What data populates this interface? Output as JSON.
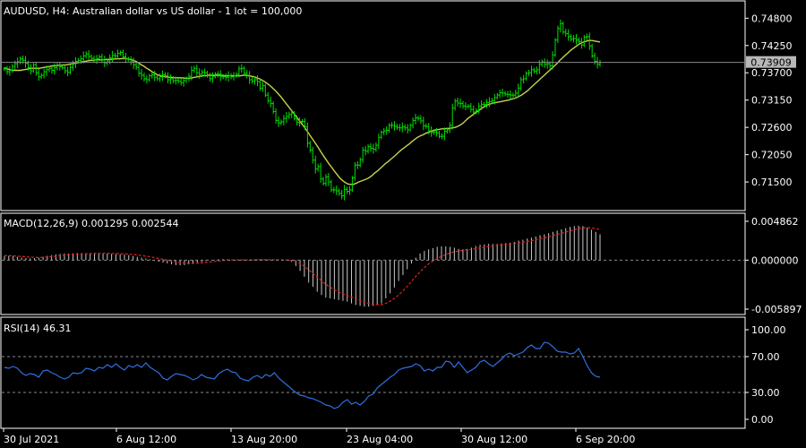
{
  "header": {
    "symbol_line": "AUDUSD, H4:  Australian dollar vs US dollar - 1 lot = 100,000"
  },
  "macd_header": "MACD(12,26,9) 0.001295 0.002544",
  "rsi_header": "RSI(14) 46.31",
  "price_badge": "0.73909",
  "colors": {
    "background": "#000000",
    "candle": "#00e000",
    "ma_line": "#c8d24b",
    "macd_histogram": "#c8c8c8",
    "macd_signal": "#e02020",
    "rsi_line": "#2f6fe0",
    "axis": "#ffffff",
    "level_lines": "#8a8a8a"
  },
  "chart_data": [
    {
      "type": "line",
      "name": "price",
      "x_tick_labels": [
        "30 Jul 2021",
        "6 Aug 12:00",
        "13 Aug 20:00",
        "23 Aug 04:00",
        "30 Aug 12:00",
        "6 Sep 20:00"
      ],
      "y_tick_labels": [
        "0.74800",
        "0.74250",
        "0.73700",
        "0.73150",
        "0.72600",
        "0.72050",
        "0.71500"
      ],
      "ylim": [
        0.7105,
        0.7495
      ],
      "current_price": 0.73909,
      "series": [
        {
          "name": "close",
          "values": [
            0.7378,
            0.7372,
            0.7375,
            0.7383,
            0.7388,
            0.7392,
            0.7398,
            0.7395,
            0.7389,
            0.738,
            0.7374,
            0.7386,
            0.737,
            0.7362,
            0.7365,
            0.7372,
            0.7376,
            0.7379,
            0.7375,
            0.738,
            0.7384,
            0.7382,
            0.738,
            0.7374,
            0.7371,
            0.7381,
            0.7388,
            0.7393,
            0.7395,
            0.7398,
            0.7404,
            0.7408,
            0.7403,
            0.7399,
            0.7396,
            0.7398,
            0.7402,
            0.7396,
            0.739,
            0.7394,
            0.74,
            0.7405,
            0.7404,
            0.7409,
            0.7411,
            0.7402,
            0.7398,
            0.7397,
            0.7392,
            0.7386,
            0.7381,
            0.7369,
            0.7365,
            0.7358,
            0.7356,
            0.7364,
            0.7366,
            0.7361,
            0.7358,
            0.7362,
            0.7366,
            0.7364,
            0.7356,
            0.7358,
            0.7354,
            0.7355,
            0.7353,
            0.735,
            0.7354,
            0.7358,
            0.7363,
            0.7375,
            0.7379,
            0.737,
            0.7367,
            0.7371,
            0.737,
            0.7364,
            0.7358,
            0.7363,
            0.7367,
            0.7367,
            0.7362,
            0.7362,
            0.7361,
            0.7364,
            0.7362,
            0.7364,
            0.7367,
            0.7378,
            0.7379,
            0.7369,
            0.7365,
            0.7356,
            0.7353,
            0.7356,
            0.7352,
            0.7339,
            0.7344,
            0.7325,
            0.7314,
            0.7308,
            0.7292,
            0.7274,
            0.7269,
            0.7271,
            0.7278,
            0.7282,
            0.7286,
            0.7289,
            0.7278,
            0.727,
            0.7272,
            0.7272,
            0.7261,
            0.7228,
            0.7214,
            0.7194,
            0.7176,
            0.7181,
            0.7156,
            0.7147,
            0.716,
            0.715,
            0.7134,
            0.7134,
            0.7132,
            0.7127,
            0.7122,
            0.7135,
            0.7131,
            0.7134,
            0.7158,
            0.7184,
            0.7184,
            0.7195,
            0.7214,
            0.7212,
            0.7221,
            0.7218,
            0.7216,
            0.7224,
            0.724,
            0.725,
            0.7253,
            0.7254,
            0.7264,
            0.7264,
            0.7262,
            0.726,
            0.7259,
            0.7261,
            0.7259,
            0.7255,
            0.7264,
            0.7274,
            0.7279,
            0.7278,
            0.7273,
            0.7263,
            0.7262,
            0.7253,
            0.725,
            0.7251,
            0.7249,
            0.7242,
            0.7242,
            0.7252,
            0.7255,
            0.7264,
            0.7299,
            0.7313,
            0.7309,
            0.7308,
            0.7303,
            0.7302,
            0.7303,
            0.7296,
            0.7291,
            0.7294,
            0.7303,
            0.7306,
            0.7306,
            0.731,
            0.7312,
            0.7314,
            0.732,
            0.7325,
            0.733,
            0.7329,
            0.7327,
            0.7326,
            0.7325,
            0.7325,
            0.7329,
            0.7339,
            0.7356,
            0.7358,
            0.7369,
            0.737,
            0.7376,
            0.7373,
            0.7376,
            0.7387,
            0.7392,
            0.7387,
            0.7388,
            0.7384,
            0.7406,
            0.7436,
            0.7459,
            0.7469,
            0.7452,
            0.7449,
            0.7443,
            0.7438,
            0.7439,
            0.7436,
            0.7433,
            0.7426,
            0.7442,
            0.7443,
            0.7424,
            0.7404,
            0.7393,
            0.7387,
            0.7391
          ]
        },
        {
          "name": "moving_average",
          "values": [
            0.738,
            0.7378,
            0.7376,
            0.7375,
            0.7375,
            0.7375,
            0.7375,
            0.7376,
            0.7377,
            0.7378,
            0.7379,
            0.7379,
            0.7379,
            0.7379,
            0.738,
            0.7381,
            0.7382,
            0.7383,
            0.7384,
            0.7384,
            0.7385,
            0.7385,
            0.7386,
            0.7386,
            0.7387,
            0.7388,
            0.7389,
            0.739,
            0.7391,
            0.7392,
            0.7393,
            0.7394,
            0.7395,
            0.7395,
            0.7396,
            0.7396,
            0.7396,
            0.7396,
            0.7397,
            0.7397,
            0.7397,
            0.7398,
            0.7398,
            0.7398,
            0.7399,
            0.7399,
            0.7398,
            0.7397,
            0.7395,
            0.7393,
            0.739,
            0.7386,
            0.7383,
            0.7379,
            0.7376,
            0.7372,
            0.7369,
            0.7366,
            0.7364,
            0.7363,
            0.7362,
            0.7361,
            0.7361,
            0.736,
            0.736,
            0.736,
            0.736,
            0.7359,
            0.7359,
            0.7359,
            0.736,
            0.7361,
            0.7362,
            0.7363,
            0.7364,
            0.7364,
            0.7365,
            0.7365,
            0.7365,
            0.7365,
            0.7365,
            0.7365,
            0.7364,
            0.7364,
            0.7364,
            0.7364,
            0.7364,
            0.7364,
            0.7364,
            0.7365,
            0.7365,
            0.7364,
            0.7363,
            0.7362,
            0.736,
            0.7358,
            0.7355,
            0.7352,
            0.7348,
            0.7344,
            0.7339,
            0.7334,
            0.7328,
            0.7322,
            0.7315,
            0.7308,
            0.7301,
            0.7294,
            0.7287,
            0.728,
            0.7273,
            0.7266,
            0.7259,
            0.7251,
            0.7243,
            0.7235,
            0.7227,
            0.7219,
            0.721,
            0.7202,
            0.7194,
            0.7186,
            0.7179,
            0.7172,
            0.7165,
            0.7158,
            0.7153,
            0.7149,
            0.7146,
            0.7145,
            0.7145,
            0.7147,
            0.715,
            0.7152,
            0.7154,
            0.7156,
            0.7159,
            0.7163,
            0.7168,
            0.7172,
            0.7177,
            0.7182,
            0.7187,
            0.7191,
            0.7196,
            0.72,
            0.7205,
            0.721,
            0.7215,
            0.7219,
            0.7223,
            0.7227,
            0.7232,
            0.7236,
            0.724,
            0.7243,
            0.7245,
            0.7248,
            0.725,
            0.7252,
            0.7254,
            0.7255,
            0.7256,
            0.7257,
            0.7257,
            0.7258,
            0.7258,
            0.7259,
            0.726,
            0.7262,
            0.7265,
            0.7269,
            0.7274,
            0.7279,
            0.7283,
            0.7287,
            0.7291,
            0.7295,
            0.7299,
            0.7302,
            0.7305,
            0.7307,
            0.7309,
            0.731,
            0.7311,
            0.7312,
            0.7313,
            0.7314,
            0.7315,
            0.7317,
            0.7318,
            0.732,
            0.7323,
            0.7326,
            0.733,
            0.7334,
            0.7339,
            0.7344,
            0.7349,
            0.7354,
            0.7359,
            0.7364,
            0.7369,
            0.7374,
            0.7379,
            0.7384,
            0.7389,
            0.7395,
            0.74,
            0.7405,
            0.741,
            0.7415,
            0.7419,
            0.7423,
            0.7427,
            0.743,
            0.7432,
            0.7434,
            0.7435,
            0.7435,
            0.7434,
            0.7433,
            0.7432
          ]
        }
      ]
    },
    {
      "type": "bar",
      "name": "macd",
      "y_tick_labels": [
        "0.004862",
        "0.000000",
        "-0.005897"
      ],
      "ylim": [
        -0.006,
        0.0051
      ],
      "series": [
        {
          "name": "histogram",
          "values": [
            0.0005,
            0.00052,
            0.0005,
            0.0004,
            0.0003,
            0.00025,
            0.00022,
            0.00024,
            0.0003,
            0.0004,
            0.00052,
            0.0006,
            0.0007,
            0.00075,
            0.0008,
            0.0008,
            0.00082,
            0.00085,
            0.00082,
            0.0008,
            0.00082,
            0.00086,
            0.00084,
            0.00082,
            0.0008,
            0.00076,
            0.00074,
            0.0007,
            0.00066,
            0.0006,
            0.0005,
            0.0004,
            0.0003,
            0.0002,
            0.0001,
            -0.0001,
            -0.0002,
            -0.0003,
            -0.0004,
            -0.0005,
            -0.0006,
            -0.00062,
            -0.0006,
            -0.0005,
            -0.0004,
            -0.0003,
            -0.0002,
            -0.0001,
            0.0,
            5e-05,
            0.0001,
            0.00012,
            0.0001,
            5e-05,
            0.0,
            -2e-05,
            -1e-05,
            2e-05,
            5e-05,
            8e-05,
            0.0001,
            8e-05,
            5e-05,
            2e-05,
            0.0,
            -1e-05,
            -3e-05,
            -0.0002,
            -0.0007,
            -0.0013,
            -0.002,
            -0.0027,
            -0.0032,
            -0.0038,
            -0.0042,
            -0.0045,
            -0.0046,
            -0.0047,
            -0.0048,
            -0.0049,
            -0.005,
            -0.0052,
            -0.0054,
            -0.0055,
            -0.0056,
            -0.0056,
            -0.0055,
            -0.0054,
            -0.0052,
            -0.0046,
            -0.004,
            -0.0033,
            -0.0025,
            -0.0018,
            -0.0011,
            -0.0004,
            0.0003,
            0.0008,
            0.0011,
            0.0013,
            0.00145,
            0.0016,
            0.00165,
            0.00165,
            0.0016,
            0.0015,
            0.00135,
            0.0013,
            0.00135,
            0.0015,
            0.0017,
            0.00185,
            0.0019,
            0.00195,
            0.00195,
            0.00195,
            0.002,
            0.00205,
            0.0021,
            0.0022,
            0.00235,
            0.00245,
            0.0026,
            0.0027,
            0.00285,
            0.003,
            0.0031,
            0.00325,
            0.0034,
            0.00355,
            0.0037,
            0.00385,
            0.004,
            0.0041,
            0.00415,
            0.0041,
            0.0039,
            0.00365,
            0.0034,
            0.0031
          ]
        },
        {
          "name": "signal",
          "values": [
            0.00055,
            0.00053,
            0.00051,
            0.00048,
            0.00044,
            0.0004,
            0.00036,
            0.00034,
            0.00033,
            0.00034,
            0.00038,
            0.00042,
            0.00048,
            0.00054,
            0.0006,
            0.00065,
            0.00069,
            0.00073,
            0.00076,
            0.00078,
            0.00079,
            0.00081,
            0.00082,
            0.00082,
            0.00082,
            0.00081,
            0.00079,
            0.00077,
            0.00075,
            0.00072,
            0.00068,
            0.00062,
            0.00056,
            0.00048,
            0.0004,
            0.0003,
            0.0002,
            0.0001,
            0.0,
            -0.0001,
            -0.0002,
            -0.0003,
            -0.00036,
            -0.0004,
            -0.0004,
            -0.00037,
            -0.00033,
            -0.00028,
            -0.00022,
            -0.00016,
            -0.0001,
            -5e-05,
            -1e-05,
            1e-05,
            2e-05,
            2e-05,
            2e-05,
            2e-05,
            3e-05,
            4e-05,
            5e-05,
            6e-05,
            6e-05,
            5e-05,
            4e-05,
            3e-05,
            1e-05,
            -3e-05,
            -0.00016,
            -0.0004,
            -0.00075,
            -0.00115,
            -0.0016,
            -0.00205,
            -0.0025,
            -0.0029,
            -0.00325,
            -0.00355,
            -0.0038,
            -0.00405,
            -0.00425,
            -0.00445,
            -0.00465,
            -0.00485,
            -0.00505,
            -0.0052,
            -0.0053,
            -0.00535,
            -0.00535,
            -0.0052,
            -0.00495,
            -0.0046,
            -0.0042,
            -0.0037,
            -0.00315,
            -0.00255,
            -0.00195,
            -0.0014,
            -0.0009,
            -0.00045,
            -0.0001,
            0.0002,
            0.00045,
            0.00065,
            0.00085,
            0.001,
            0.0011,
            0.00118,
            0.00125,
            0.0013,
            0.00138,
            0.00147,
            0.00156,
            0.00164,
            0.00171,
            0.00177,
            0.00183,
            0.00188,
            0.00194,
            0.002,
            0.00207,
            0.00215,
            0.00224,
            0.00234,
            0.00245,
            0.00256,
            0.00268,
            0.00281,
            0.00294,
            0.00308,
            0.00322,
            0.00337,
            0.00352,
            0.00366,
            0.00378,
            0.00387,
            0.0039,
            0.00388,
            0.0038,
            0.00368
          ]
        }
      ]
    },
    {
      "type": "line",
      "name": "rsi",
      "y_tick_labels": [
        "100.00",
        "70.00",
        "30.00",
        "0.00"
      ],
      "ylim": [
        0,
        100
      ],
      "levels": [
        70,
        30
      ],
      "series": [
        {
          "name": "rsi",
          "values": [
            58,
            57,
            59,
            57,
            52,
            49,
            51,
            50,
            47,
            54,
            55,
            52,
            50,
            47,
            45,
            47,
            52,
            51,
            52,
            57,
            56,
            54,
            58,
            57,
            61,
            58,
            62,
            58,
            55,
            60,
            58,
            61,
            58,
            63,
            58,
            55,
            52,
            46,
            44,
            48,
            51,
            50,
            49,
            47,
            44,
            46,
            50,
            47,
            46,
            45,
            51,
            54,
            56,
            53,
            52,
            46,
            44,
            43,
            47,
            49,
            46,
            50,
            48,
            52,
            46,
            42,
            38,
            34,
            30,
            27,
            26,
            24,
            23,
            21,
            19,
            16,
            15,
            12,
            14,
            19,
            22,
            17,
            19,
            16,
            20,
            26,
            28,
            35,
            39,
            43,
            47,
            50,
            55,
            57,
            58,
            59,
            62,
            60,
            54,
            56,
            54,
            58,
            58,
            65,
            64,
            58,
            64,
            58,
            52,
            55,
            58,
            64,
            66,
            62,
            59,
            63,
            67,
            72,
            74,
            71,
            73,
            75,
            80,
            83,
            79,
            79,
            86,
            85,
            81,
            76,
            75,
            75,
            73,
            74,
            79,
            70,
            60,
            52,
            48,
            47
          ]
        }
      ]
    }
  ]
}
